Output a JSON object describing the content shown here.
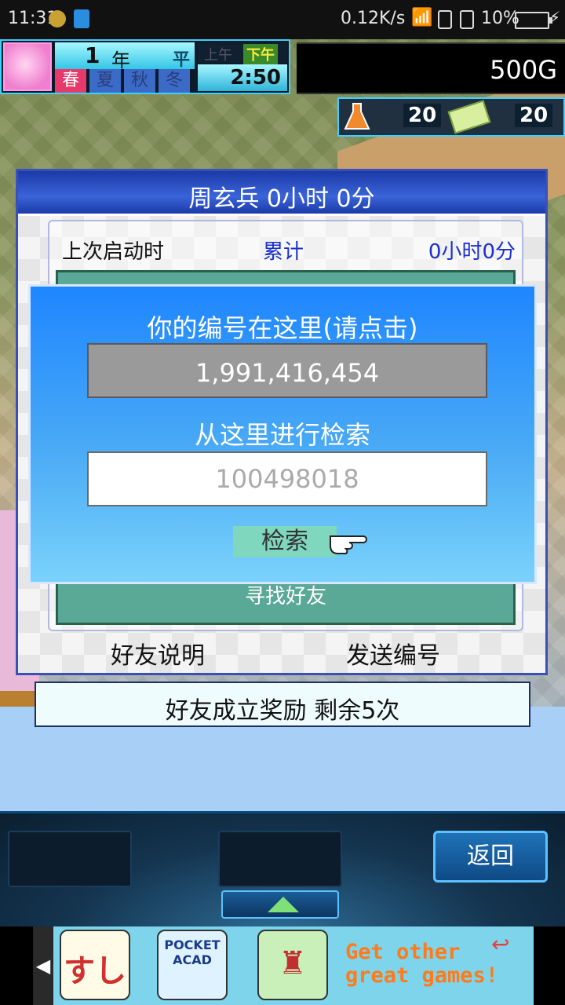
{
  "status_bar": {
    "time": "11:31",
    "network_speed": "0.12K/s",
    "battery": "10%",
    "icons": [
      "location-icon",
      "notification-icon",
      "wifi-icon",
      "sim1-icon",
      "sim2-icon",
      "battery-icon",
      "charging-icon"
    ]
  },
  "hud": {
    "year_number": "1",
    "year_unit": "年",
    "weekday": "平日",
    "seasons": [
      "春",
      "夏",
      "秋",
      "冬"
    ],
    "active_season": "春",
    "am_label": "上午",
    "pm_label": "下午",
    "clock": "2:50",
    "gold": "500G",
    "research_points": "20",
    "tickets": "20",
    "icons": [
      "avatar-icon",
      "flask-icon",
      "ticket-icon"
    ]
  },
  "friend_panel": {
    "title": "周玄兵  0小时 0分",
    "last_launch_label": "上次启动时",
    "total_label": "累计",
    "total_value": "0小时0分",
    "find_friend_label": "寻找好友",
    "help_button": "好友说明",
    "send_id_button": "发送编号"
  },
  "id_popup": {
    "title": "你的编号在这里(请点击)",
    "my_id": "1,991,416,454",
    "search_label": "从这里进行检索",
    "search_value": "100498018",
    "search_button": "检索",
    "pointer_icon": "pointing-hand-icon"
  },
  "reward_bar": {
    "text": "好友成立奖励  剩余5次"
  },
  "bottom_panel": {
    "back_button": "返回",
    "expand_icon": "up-arrow-icon"
  },
  "ad_banner": {
    "text_line1": "Get other",
    "text_line2": "great games!",
    "app2_label": "POCKET ACAD",
    "app1_glyph": "すし",
    "colors": {
      "background": "#7ed4ea",
      "text": "#ff7a1a"
    }
  }
}
